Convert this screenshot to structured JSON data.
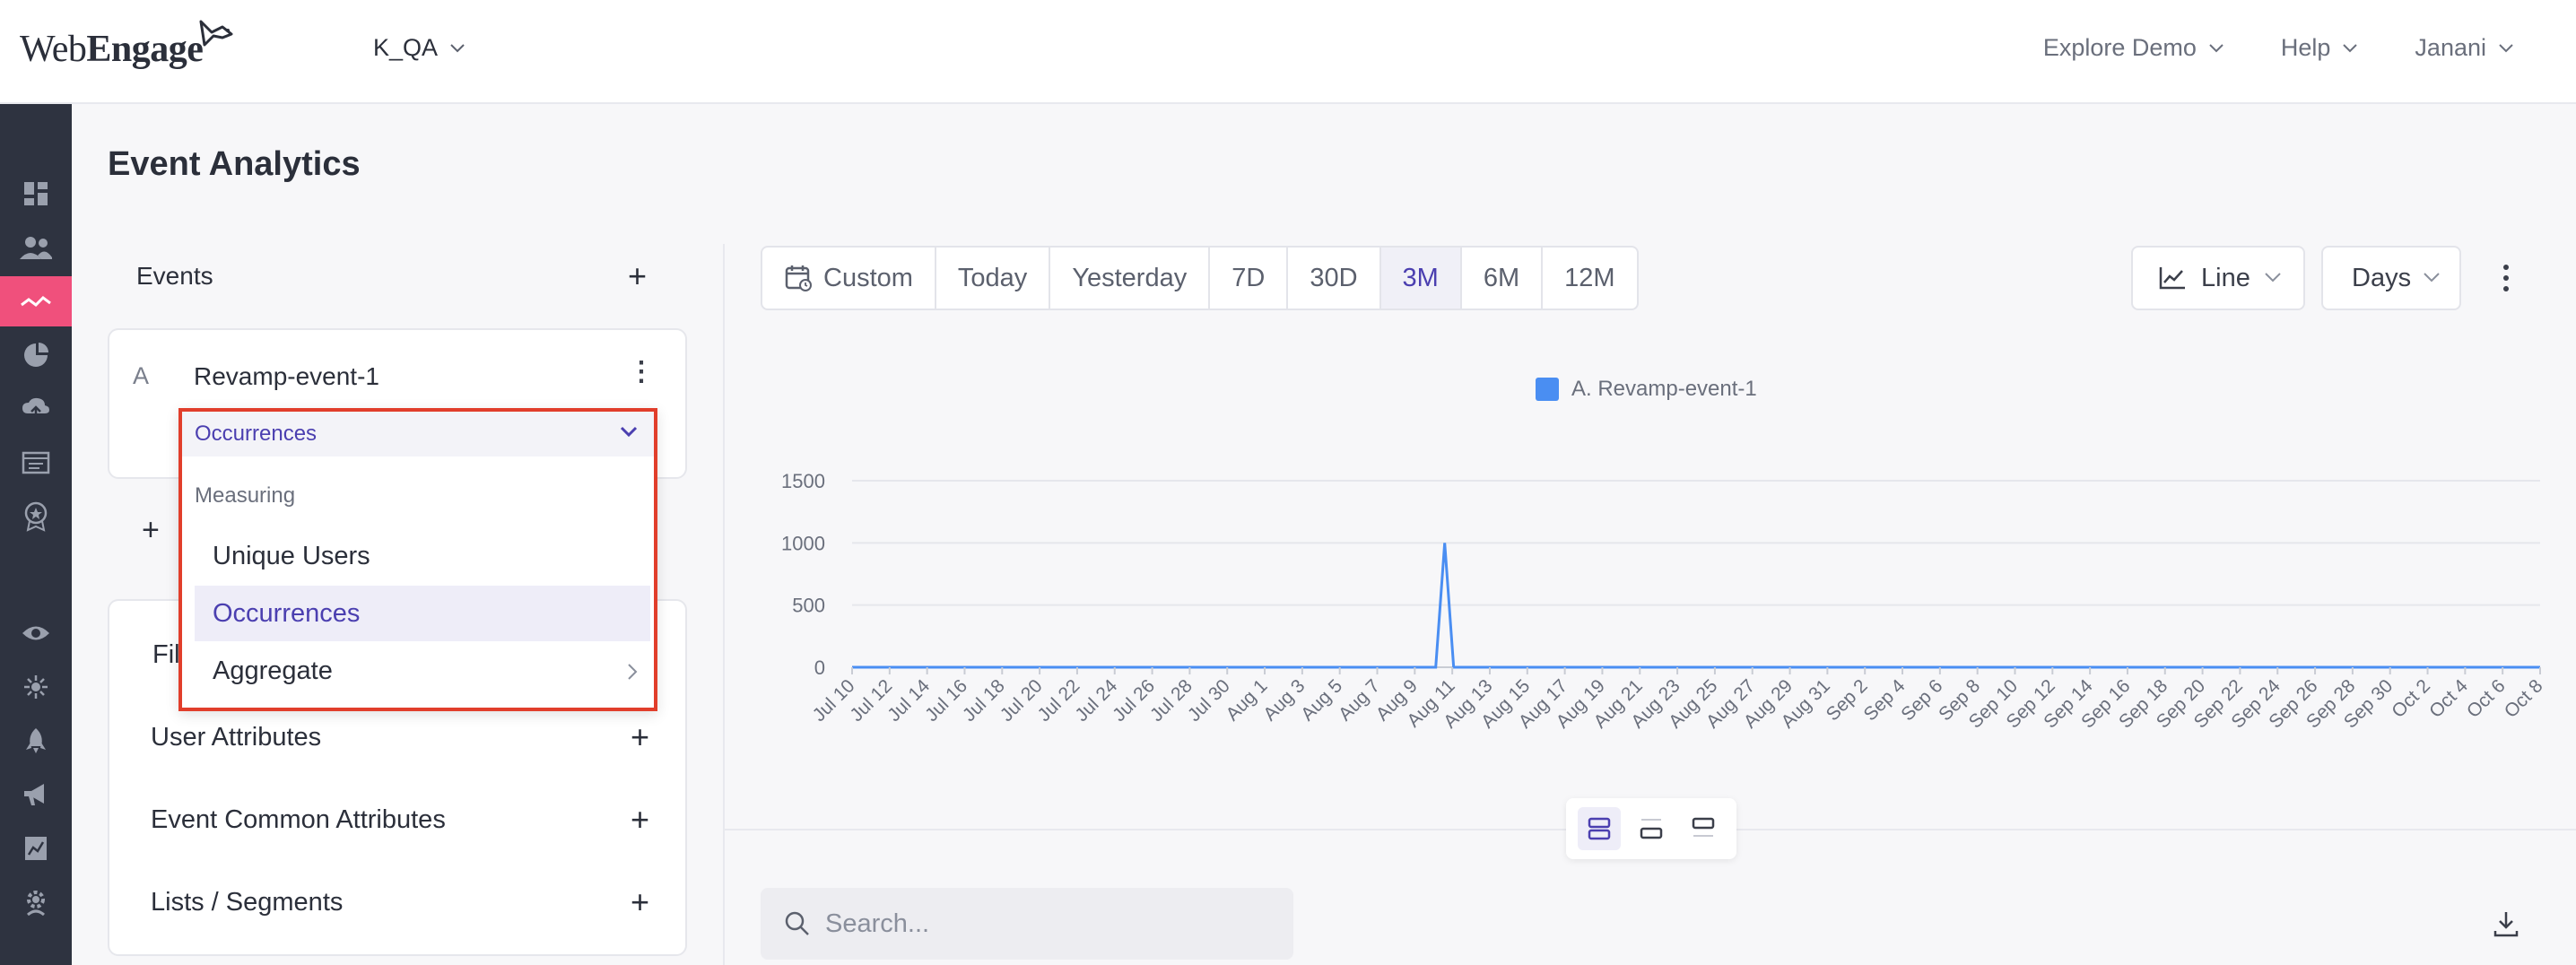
{
  "app": {
    "logo_text_1": "Web",
    "logo_text_2": "Engage",
    "project": "K_QA",
    "nav_right": [
      "Explore Demo",
      "Help",
      "Janani"
    ]
  },
  "rail": {
    "icons": [
      "dashboard-icon",
      "users-icon",
      "analytics-icon",
      "pie-chart-icon",
      "cloud-upload-icon",
      "folder-icon",
      "badge-icon",
      "eye-icon",
      "settings-spark-icon",
      "rocket-icon",
      "megaphone-icon",
      "report-icon",
      "gear-icon"
    ],
    "active": "analytics-icon"
  },
  "page": {
    "title": "Event Analytics"
  },
  "events_panel": {
    "label": "Events",
    "event": {
      "letter": "A",
      "name": "Revamp-event-1"
    }
  },
  "measure_dropdown": {
    "selected": "Occurrences",
    "section_label": "Measuring",
    "options": [
      {
        "label": "Unique Users",
        "selected": false,
        "has_submenu": false
      },
      {
        "label": "Occurrences",
        "selected": true,
        "has_submenu": false
      },
      {
        "label": "Aggregate",
        "selected": false,
        "has_submenu": true
      }
    ]
  },
  "filters_panel": {
    "partial_label": "Fil",
    "rows": [
      "User Attributes",
      "Event Common Attributes",
      "Lists / Segments"
    ]
  },
  "toolbar": {
    "ranges": [
      "Custom",
      "Today",
      "Yesterday",
      "7D",
      "30D",
      "3M",
      "6M",
      "12M"
    ],
    "active_range": "3M",
    "chart_type": "Line",
    "granularity": "Days"
  },
  "chart_data": {
    "type": "line",
    "series": [
      {
        "name": "A. Revamp-event-1",
        "color": "#4a8ef2",
        "values": [
          0,
          0,
          0,
          0,
          0,
          0,
          0,
          0,
          0,
          0,
          0,
          0,
          0,
          0,
          0,
          0,
          0,
          0,
          0,
          0,
          0,
          0,
          0,
          0,
          0,
          0,
          0,
          0,
          0,
          0,
          0,
          0,
          0,
          0,
          0,
          0,
          0,
          0,
          0,
          0,
          0,
          0,
          0,
          0,
          0,
          0,
          0,
          0,
          0,
          0,
          0,
          0,
          0,
          0,
          0,
          0,
          0,
          0,
          0,
          0,
          0,
          0,
          0,
          0,
          0,
          0,
          1000,
          0,
          0,
          0,
          0,
          0,
          0,
          0,
          0,
          0,
          0,
          0,
          0,
          0,
          0,
          0,
          0,
          0,
          0,
          0,
          0,
          0,
          0,
          0,
          0,
          0,
          0,
          0,
          0,
          0,
          0,
          0,
          0,
          0,
          0,
          0,
          0,
          0,
          0,
          0,
          0,
          0,
          0,
          0,
          0,
          0,
          0,
          0,
          0,
          0,
          0,
          0,
          0,
          0,
          0,
          0,
          0,
          0,
          0,
          0,
          0,
          0,
          0,
          0,
          0,
          0,
          0,
          0,
          0,
          0,
          0,
          0,
          0,
          0,
          0,
          0,
          0,
          0,
          0,
          0,
          0,
          0,
          0,
          0,
          0,
          0,
          0,
          0,
          0,
          0,
          0,
          0,
          0,
          0,
          0,
          0,
          0,
          0,
          0,
          0,
          0,
          0,
          0,
          0,
          0,
          0,
          0,
          0,
          0,
          0,
          0,
          0,
          0,
          0,
          0,
          0,
          0,
          0,
          0,
          0,
          0,
          0,
          0
        ]
      }
    ],
    "x_tick_labels": [
      "Jul 10",
      "Jul 12",
      "Jul 14",
      "Jul 16",
      "Jul 18",
      "Jul 20",
      "Jul 22",
      "Jul 24",
      "Jul 26",
      "Jul 28",
      "Jul 30",
      "Aug 1",
      "Aug 3",
      "Aug 5",
      "Aug 7",
      "Aug 9",
      "Aug 11",
      "Aug 13",
      "Aug 15",
      "Aug 17",
      "Aug 19",
      "Aug 21",
      "Aug 23",
      "Aug 25",
      "Aug 27",
      "Aug 29",
      "Aug 31",
      "Sep 2",
      "Sep 4",
      "Sep 6",
      "Sep 8",
      "Sep 10",
      "Sep 12",
      "Sep 14",
      "Sep 16",
      "Sep 18",
      "Sep 20",
      "Sep 22",
      "Sep 24",
      "Sep 26",
      "Sep 28",
      "Sep 30",
      "Oct 2",
      "Oct 4",
      "Oct 6",
      "Oct 8"
    ],
    "y_ticks": [
      0,
      500,
      1000,
      1500
    ],
    "ylim": [
      0,
      1500
    ],
    "grid": true,
    "legend_position": "top-center"
  },
  "search": {
    "placeholder": "Search..."
  }
}
